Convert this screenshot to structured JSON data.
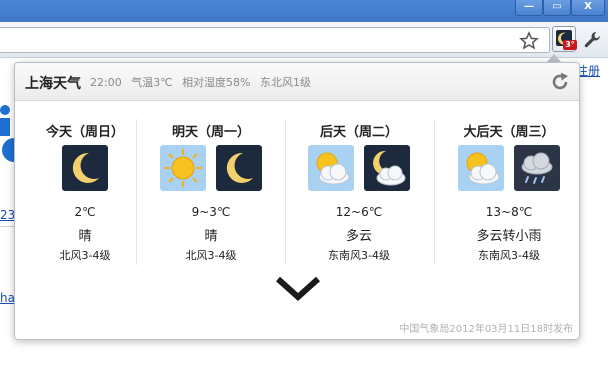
{
  "window": {
    "minimize": "—",
    "maximize": "▭",
    "close": "X"
  },
  "background": {
    "register": "注册",
    "link1": "23",
    "link2": "ha"
  },
  "extension": {
    "badge": "3°"
  },
  "weather": {
    "city": "上海天气",
    "current": {
      "time": "22:00",
      "temperature": "气温3℃",
      "humidity": "相对湿度58%",
      "wind": "东北风1级"
    },
    "days": [
      {
        "name": "今天（周日）",
        "icons": [
          "moon-icon"
        ],
        "temp": "2℃",
        "cond": "晴",
        "wind": "北风3-4级"
      },
      {
        "name": "明天（周一）",
        "icons": [
          "sun-icon",
          "moon-icon"
        ],
        "temp": "9~3℃",
        "cond": "晴",
        "wind": "北风3-4级"
      },
      {
        "name": "后天（周二）",
        "icons": [
          "partly-cloudy-day-icon",
          "partly-cloudy-night-icon"
        ],
        "temp": "12~6℃",
        "cond": "多云",
        "wind": "东南风3-4级"
      },
      {
        "name": "大后天（周三）",
        "icons": [
          "partly-cloudy-day-icon",
          "rain-cloud-icon"
        ],
        "temp": "13~8℃",
        "cond": "多云转小雨",
        "wind": "东南风3-4级"
      }
    ],
    "footer": "中国气象局2012年03月11日18时发布"
  },
  "colors": {
    "chrome_blue": "#3f77c8",
    "night_bg": "#1d2a3d",
    "day_bg": "#9cc8ee"
  }
}
